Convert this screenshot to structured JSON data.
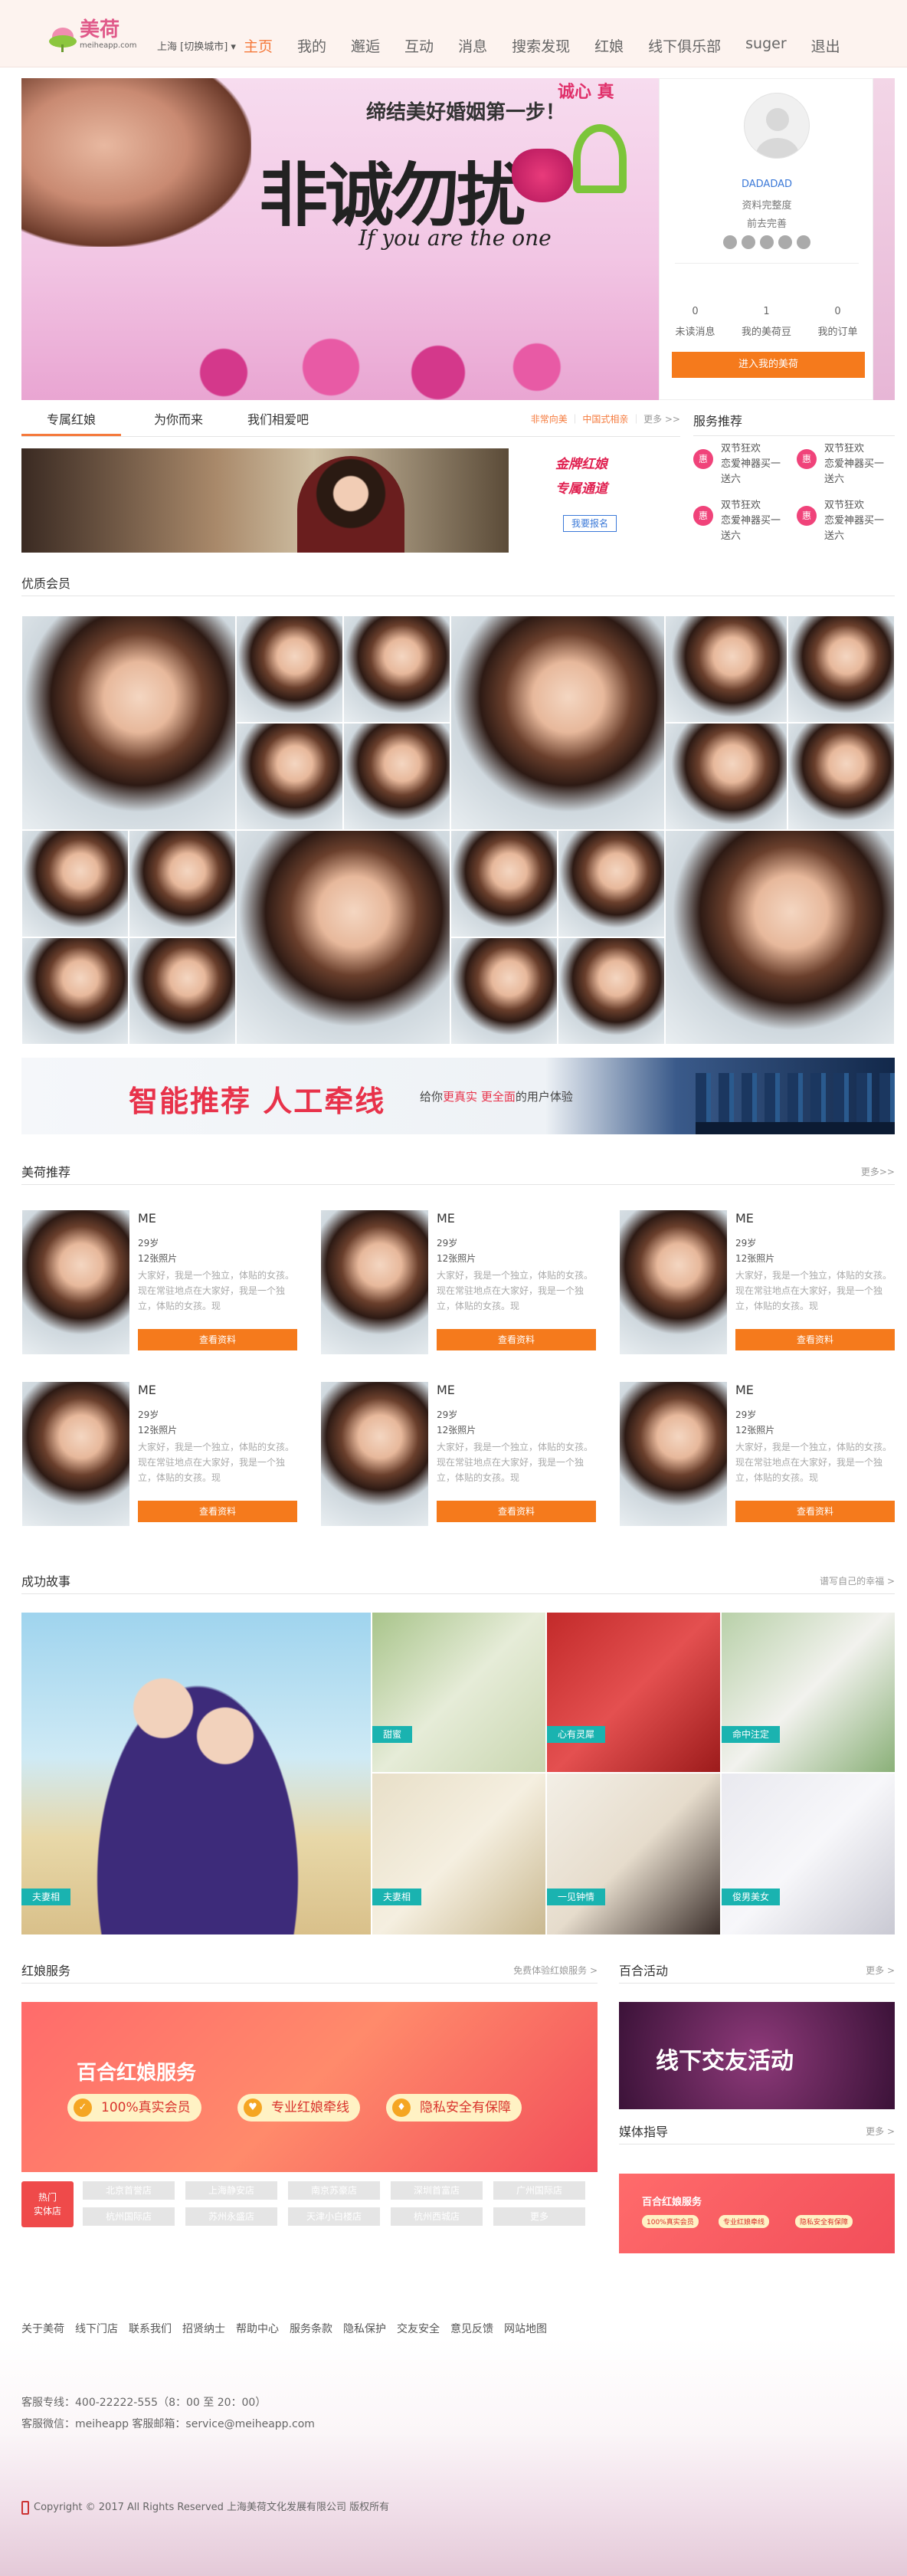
{
  "header": {
    "logo_text": "美荷",
    "logo_sub": "meiheapp.com",
    "city": "上海 [切换城市]",
    "nav": [
      "主页",
      "我的",
      "邂逅",
      "互动",
      "消息",
      "搜索发现",
      "红娘",
      "线下俱乐部",
      "suger",
      "退出"
    ],
    "active_nav": 0
  },
  "banner": {
    "slogan": "缔结美好婚姻第一步！",
    "big": "非诚勿扰",
    "sub": "If you are the one",
    "tag": "诚心  真"
  },
  "profile": {
    "username": "DADADAD",
    "complete": "资料完整度",
    "go": "前去完善",
    "stats": [
      {
        "value": "0",
        "label": "未读消息"
      },
      {
        "value": "1",
        "label": "我的美荷豆"
      },
      {
        "value": "0",
        "label": "我的订单"
      }
    ],
    "enter_label": "进入我的美荷"
  },
  "tabs": {
    "items": [
      "专属红娘",
      "为你而来",
      "我们相爱吧"
    ],
    "links": [
      "非常向美",
      "中国式相亲",
      "更多 >>"
    ]
  },
  "service": {
    "title": "服务推荐",
    "items": [
      {
        "icon": "惠",
        "line1": "双节狂欢",
        "line2": "恋爱神器买一送六"
      },
      {
        "icon": "惠",
        "line1": "双节狂欢",
        "line2": "恋爱神器买一送六"
      },
      {
        "icon": "惠",
        "line1": "双节狂欢",
        "line2": "恋爱神器买一送六"
      },
      {
        "icon": "惠",
        "line1": "双节狂欢",
        "line2": "恋爱神器买一送六"
      }
    ]
  },
  "hongniang_promo": {
    "line1": "金牌红娘",
    "line2": "专属通道",
    "button": "我要报名"
  },
  "members": {
    "title": "优质会员"
  },
  "smart": {
    "big": "智能推荐  人工牵线",
    "small_pre": "给你",
    "small_a": "更真实",
    "small_b": "更全面",
    "small_post": "的用户体验"
  },
  "recommend": {
    "title": "美荷推荐",
    "more": "更多>>",
    "cards": [
      {
        "name": "ME",
        "age": "29岁",
        "photos": "12张照片",
        "desc": "大家好，我是一个独立，体贴的女孩。现在常驻地点在大家好，我是一个独立，体贴的女孩。现",
        "button": "查看资料"
      },
      {
        "name": "ME",
        "age": "29岁",
        "photos": "12张照片",
        "desc": "大家好，我是一个独立，体贴的女孩。现在常驻地点在大家好，我是一个独立，体贴的女孩。现",
        "button": "查看资料"
      },
      {
        "name": "ME",
        "age": "29岁",
        "photos": "12张照片",
        "desc": "大家好，我是一个独立，体贴的女孩。现在常驻地点在大家好，我是一个独立，体贴的女孩。现",
        "button": "查看资料"
      },
      {
        "name": "ME",
        "age": "29岁",
        "photos": "12张照片",
        "desc": "大家好，我是一个独立，体贴的女孩。现在常驻地点在大家好，我是一个独立，体贴的女孩。现",
        "button": "查看资料"
      },
      {
        "name": "ME",
        "age": "29岁",
        "photos": "12张照片",
        "desc": "大家好，我是一个独立，体贴的女孩。现在常驻地点在大家好，我是一个独立，体贴的女孩。现",
        "button": "查看资料"
      },
      {
        "name": "ME",
        "age": "29岁",
        "photos": "12张照片",
        "desc": "大家好，我是一个独立，体贴的女孩。现在常驻地点在大家好，我是一个独立，体贴的女孩。现",
        "button": "查看资料"
      }
    ]
  },
  "stories": {
    "title": "成功故事",
    "more": "谱写自己的幸福 >",
    "labels": [
      "夫妻相",
      "甜蜜",
      "心有灵犀",
      "命中注定",
      "夫妻相",
      "一见钟情",
      "俊男美女"
    ]
  },
  "hn_service": {
    "title": "红娘服务",
    "more": "免费体验红娘服务 >",
    "banner_title": "百合红娘服务",
    "pills": [
      "100%真实会员",
      "专业红娘牵线",
      "隐私安全有保障"
    ],
    "hot": "热门\n实体店",
    "stores": [
      "北京首誉店",
      "上海静安店",
      "南京苏豪店",
      "深圳首富店",
      "广州国际店",
      "杭州国际店",
      "苏州永盛店",
      "天津小白楼店",
      "杭州西城店",
      "更多"
    ]
  },
  "activity": {
    "title": "百合活动",
    "more": "更多 >",
    "banner": "线下交友活动"
  },
  "media": {
    "title": "媒体指导",
    "more": "更多 >"
  },
  "footer": {
    "links": [
      "关于美荷",
      "线下门店",
      "联系我们",
      "招贤纳士",
      "帮助中心",
      "服务条款",
      "隐私保护",
      "交友安全",
      "意见反馈",
      "网站地图"
    ],
    "hotline": "客服专线：400-22222-555（8：00 至 20：00）",
    "wechat": "客服微信：meiheapp 客服邮箱：service@meiheapp.com",
    "copyright": "Copyright © 2017 All Rights Reserved 上海美荷文化发展有限公司 版权所有"
  }
}
